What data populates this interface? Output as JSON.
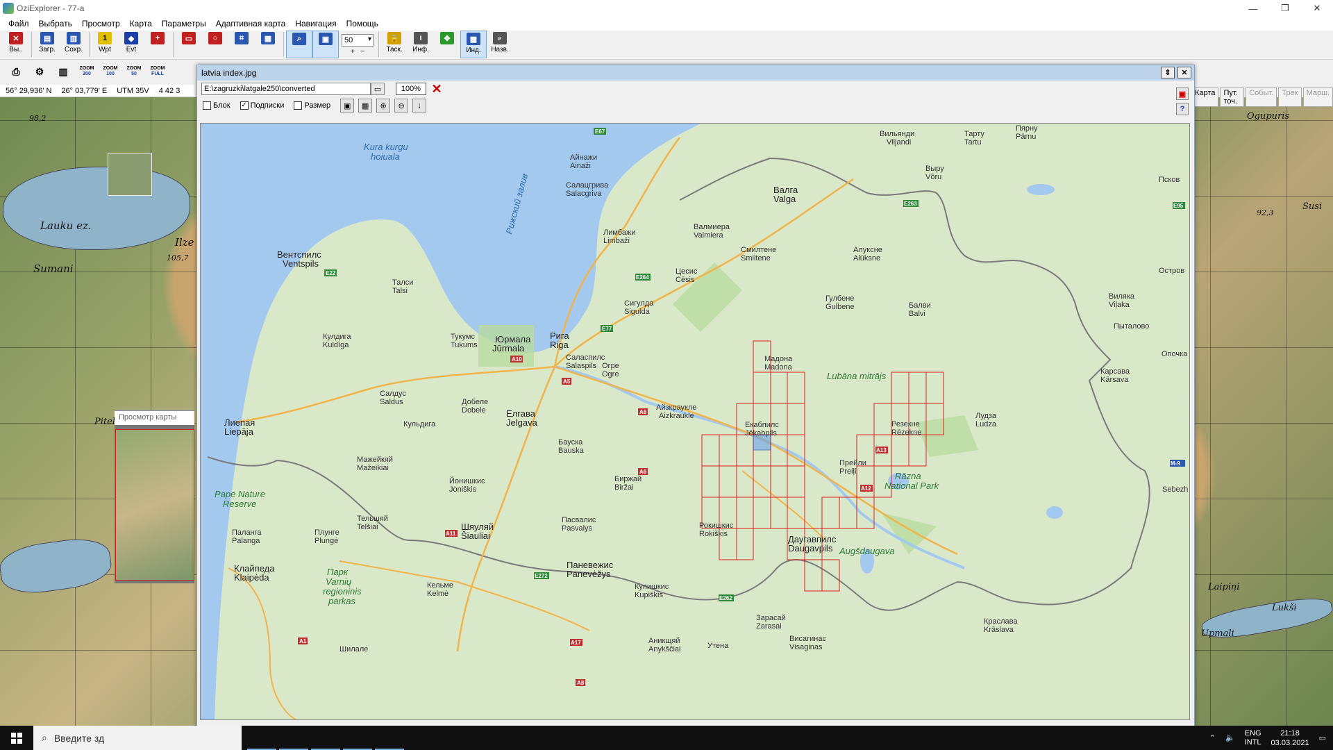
{
  "window": {
    "title": "OziExplorer - 77-a"
  },
  "menu": [
    "Файл",
    "Выбрать",
    "Просмотр",
    "Карта",
    "Параметры",
    "Адаптивная карта",
    "Навигация",
    "Помощь"
  ],
  "toolbar": {
    "buttons": [
      {
        "label": "Вы..",
        "icon": "exit-icon",
        "color": "#c02020"
      },
      {
        "label": "Загр.",
        "icon": "load-icon",
        "color": "#2a58b0"
      },
      {
        "label": "Сохр.",
        "icon": "save-icon",
        "color": "#2a58b0"
      },
      {
        "label": "Wpt",
        "icon": "waypoint-icon",
        "color": "#e0c000"
      },
      {
        "label": "Evt",
        "icon": "event-icon",
        "color": "#1a3fa8"
      },
      {
        "label": "",
        "icon": "track-icon",
        "color": "#c02020"
      },
      {
        "label": "",
        "icon": "show-waypoints-icon",
        "color": "#c02020"
      },
      {
        "label": "",
        "icon": "show-events-icon",
        "color": "#c02020"
      },
      {
        "label": "",
        "icon": "show-routes-icon",
        "color": "#2a58b0"
      },
      {
        "label": "",
        "icon": "map-grid-icon",
        "color": "#2a58b0"
      },
      {
        "label": "",
        "icon": "magnifier-icon",
        "color": "#2a58b0"
      },
      {
        "label": "",
        "icon": "map-overview-icon",
        "color": "#2a58b0"
      }
    ],
    "zoom_value": "50",
    "right_buttons": [
      {
        "label": "Таск.",
        "icon": "lock-icon",
        "color": "#d4a000"
      },
      {
        "label": "Инф.",
        "icon": "info-icon",
        "color": "#555555"
      },
      {
        "label": "",
        "icon": "move-arrows-icon",
        "color": "#2a9a2a"
      },
      {
        "label": "Инд.",
        "icon": "index-map-icon",
        "color": "#2a58b0"
      },
      {
        "label": "Назв.",
        "icon": "name-search-icon",
        "color": "#555555"
      }
    ]
  },
  "toolbar2": {
    "zooms": [
      {
        "top": "ZOOM",
        "val": "200"
      },
      {
        "top": "ZOOM",
        "val": "100"
      },
      {
        "top": "ZOOM",
        "val": "50"
      },
      {
        "top": "ZOOM",
        "val": "FULL"
      }
    ]
  },
  "coords": {
    "lat": "56° 29,936' N",
    "lon": "26° 03,779' E",
    "utm": "UTM  35V",
    "east": "4 42 3"
  },
  "right_tabs": [
    "Карта",
    "Пут. точ.",
    "Событ.",
    "Трек",
    "Марш."
  ],
  "topo_labels": [
    "Lauku ez.",
    "Sumani",
    "Ilze",
    "Piteli",
    "98,2",
    "105,7",
    "92,3",
    "Ogupuris",
    "Susi",
    "Lukši",
    "Upmali",
    "Laipiņi"
  ],
  "preview": {
    "title": "Просмотр карты"
  },
  "dialog": {
    "title": "latvia index.jpg",
    "path": "E:\\zagruzki\\latgale250\\converted",
    "zoom_pct": "100%",
    "checkboxes": [
      {
        "label": "Блок",
        "checked": false
      },
      {
        "label": "Подписки",
        "checked": true
      },
      {
        "label": "Размер",
        "checked": false
      }
    ]
  },
  "map": {
    "sea_labels": [
      "Kura kurgu",
      "hoiuala",
      "Рижский залив"
    ],
    "green_labels": [
      "Pape Nature",
      "Reserve",
      "Lubāna mitrājs",
      "Rāzna",
      "National Park",
      "Augšdaugava",
      "Парк",
      "Varnių",
      "regioninis",
      "parkas"
    ],
    "cities_big": [
      "Рига",
      "Riga",
      "Юрмала",
      "Jūrmala",
      "Вентспилс",
      "Ventspils",
      "Лиепая",
      "Liepāja",
      "Елгава",
      "Jelgava",
      "Даугавпилс",
      "Daugavpils",
      "Клайпеда",
      "Klaipėda",
      "Шяуляй",
      "Šiauliai",
      "Паневежис",
      "Panevėžys",
      "Валга",
      "Valga",
      "Резекне",
      "Rēzekne",
      "Екабпилс",
      "Jēkabpils",
      "Мадона",
      "Madona"
    ],
    "cities": [
      "Пярну",
      "Pärnu",
      "Вильянди",
      "Viljandi",
      "Тарту",
      "Tartu",
      "Выру",
      "Võru",
      "Псков",
      "Лимбажи",
      "Limbaži",
      "Валмиера",
      "Valmiera",
      "Цесис",
      "Cēsis",
      "Сигулда",
      "Sigulda",
      "Смилтене",
      "Smiltene",
      "Алуксне",
      "Alūksne",
      "Гулбене",
      "Gulbene",
      "Балви",
      "Balvi",
      "Талси",
      "Talsi",
      "Тукумс",
      "Tukums",
      "Кулдига",
      "Kuldīga",
      "Салдус",
      "Saldus",
      "Добеле",
      "Dobele",
      "Бауска",
      "Bauska",
      "Огре",
      "Ogre",
      "Саласпилс",
      "Salaspils",
      "Айзкраукле",
      "Aizkraukle",
      "Прейли",
      "Preiļi",
      "Лудза",
      "Ludza",
      "Краслава",
      "Krāslava",
      "Мажейкяй",
      "Mažeikiai",
      "Тельшяй",
      "Telšiai",
      "Плунге",
      "Plungė",
      "Паланга",
      "Palanga",
      "Кельме",
      "Kelmė",
      "Биржай",
      "Biržai",
      "Рокишкис",
      "Rokiškis",
      "Зарасай",
      "Zarasai",
      "Висагинас",
      "Visaginas",
      "Утена",
      "Шилале",
      "Аникщяй",
      "Anykščiai",
      "Купишкис",
      "Kupiškis",
      "Пасвалис",
      "Pasvalys",
      "Йонишкис",
      "Joniškis",
      "Кульдига",
      "Айнажи",
      "Ainaži",
      "Салацгрива",
      "Salacgriva",
      "Остров",
      "Sebezh",
      "Опочка",
      "Пыталово",
      "Карсава",
      "Kārsava",
      "Виляка",
      "Viļaka"
    ],
    "roads": [
      "E67",
      "E77",
      "E22",
      "E264",
      "E263",
      "E262",
      "E272",
      "A10",
      "A6",
      "A5",
      "A12",
      "A13",
      "A1",
      "A8",
      "A17",
      "A11",
      "A6",
      "E95",
      "M-9"
    ]
  },
  "taskbar": {
    "search_placeholder": "Введите зд",
    "lang": "ENG",
    "lang2": "INTL",
    "time": "21:18",
    "date": "03.03.2021"
  }
}
